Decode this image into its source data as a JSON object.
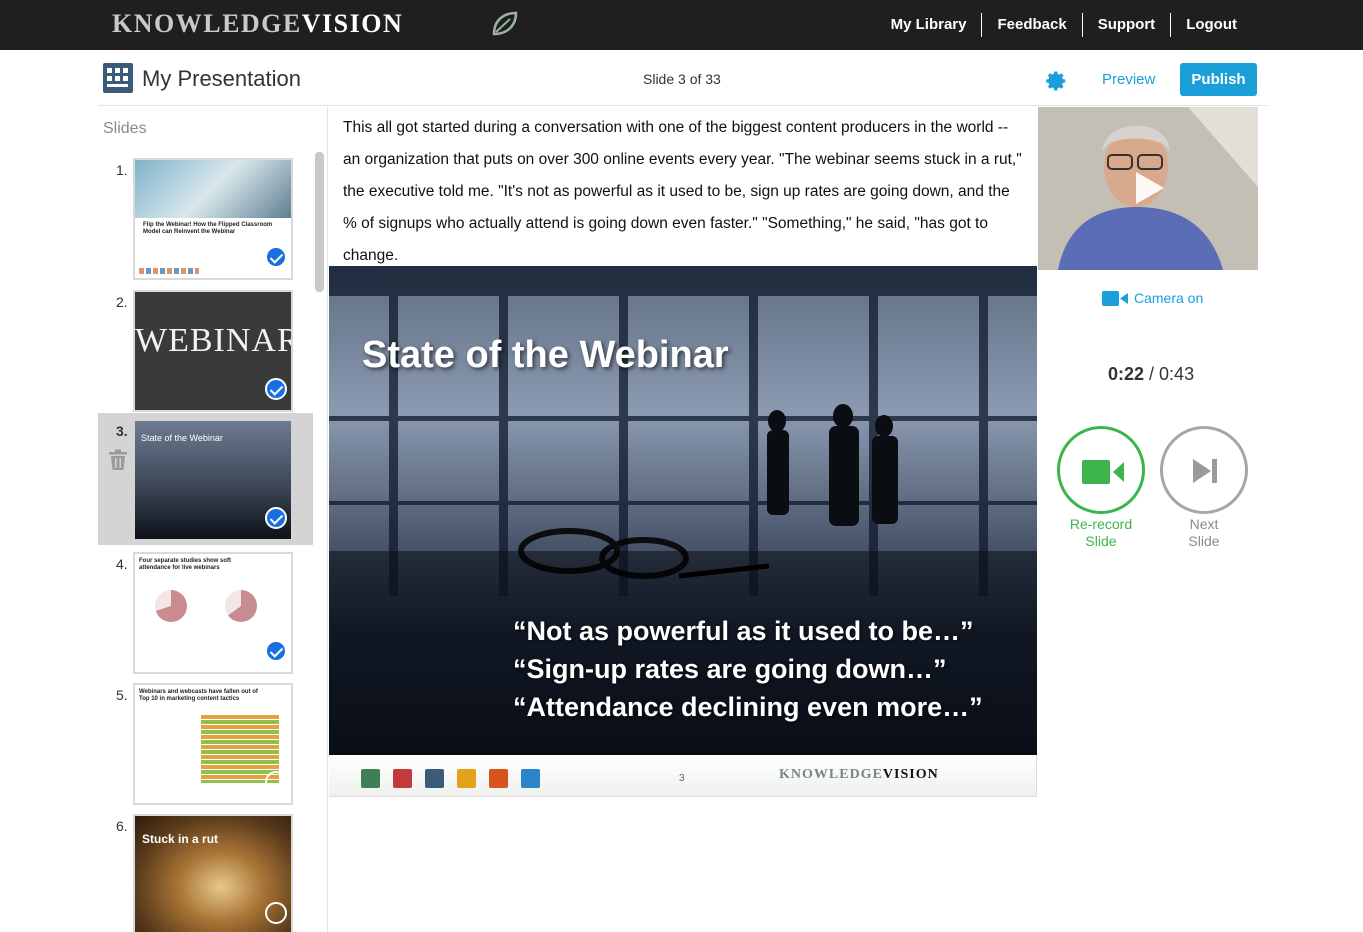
{
  "app": {
    "logo_prefix": "KNOWLEDGE",
    "logo_suffix": "VISION",
    "nav": [
      "My Library",
      "Feedback",
      "Support",
      "Logout"
    ]
  },
  "header": {
    "title": "My Presentation",
    "slide_counter": "Slide 3 of 33",
    "preview_label": "Preview",
    "publish_label": "Publish"
  },
  "sidebar": {
    "title": "Slides",
    "slides": [
      {
        "num": "1.",
        "title": "Flip the Webinar! How the Flipped Classroom Model can Reinvent the Webinar",
        "recorded": true
      },
      {
        "num": "2.",
        "title": "WEBINAR",
        "recorded": true
      },
      {
        "num": "3.",
        "title": "State of the Webinar",
        "recorded": true,
        "selected": true
      },
      {
        "num": "4.",
        "title": "Four separate studies show soft attendance for live webinars",
        "recorded": true
      },
      {
        "num": "5.",
        "title": "Webinars and webcasts have fallen out of Top 10 in marketing content tactics",
        "recorded": false
      },
      {
        "num": "6.",
        "title": "Stuck in a rut",
        "recorded": false
      }
    ]
  },
  "transcript": "This all got started during a conversation with one of the biggest content producers in the world -- an organization that puts on over 300 online events every year. \"The webinar seems stuck in a rut,\" the executive told me. \"It's not as powerful as it used to be, sign up rates are going down, and the % of signups who actually attend is going down even faster.\" \"Something,\" he said, \"has got to change.",
  "slide": {
    "title": "State of the Webinar",
    "quotes": [
      "“Not as powerful as it used to be…”",
      "“Sign-up rates are going down…”",
      "“Attendance declining even more…”"
    ],
    "page_number": "3",
    "footer_logo_prefix": "KNOWLEDGE",
    "footer_logo_suffix": "VISION"
  },
  "recorder": {
    "camera_label": "Camera on",
    "elapsed": "0:22",
    "separator": " / ",
    "total": "0:43",
    "rerecord_line1": "Re-record",
    "rerecord_line2": "Slide",
    "next_line1": "Next",
    "next_line2": "Slide"
  },
  "colors": {
    "accent": "#1a9fd8",
    "record_green": "#3bb54a",
    "topbar": "#1f1f1f"
  }
}
